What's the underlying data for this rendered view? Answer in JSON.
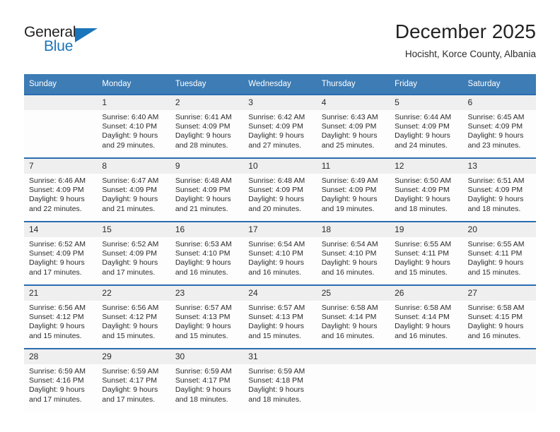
{
  "logo": {
    "text_top": "General",
    "text_bottom": "Blue",
    "accent_color": "#1b75bb",
    "triangle_icon": "triangle-icon"
  },
  "header": {
    "title": "December 2025",
    "subtitle": "Hocisht, Korce County, Albania"
  },
  "theme": {
    "header_bg": "#3d7cb5",
    "row_divider": "#2a6db0",
    "daynum_bg": "#efefef"
  },
  "calendar": {
    "weekday_headers": [
      "Sunday",
      "Monday",
      "Tuesday",
      "Wednesday",
      "Thursday",
      "Friday",
      "Saturday"
    ],
    "weeks": [
      [
        {
          "day": "",
          "lines": []
        },
        {
          "day": "1",
          "lines": [
            "Sunrise: 6:40 AM",
            "Sunset: 4:10 PM",
            "Daylight: 9 hours",
            "and 29 minutes."
          ]
        },
        {
          "day": "2",
          "lines": [
            "Sunrise: 6:41 AM",
            "Sunset: 4:09 PM",
            "Daylight: 9 hours",
            "and 28 minutes."
          ]
        },
        {
          "day": "3",
          "lines": [
            "Sunrise: 6:42 AM",
            "Sunset: 4:09 PM",
            "Daylight: 9 hours",
            "and 27 minutes."
          ]
        },
        {
          "day": "4",
          "lines": [
            "Sunrise: 6:43 AM",
            "Sunset: 4:09 PM",
            "Daylight: 9 hours",
            "and 25 minutes."
          ]
        },
        {
          "day": "5",
          "lines": [
            "Sunrise: 6:44 AM",
            "Sunset: 4:09 PM",
            "Daylight: 9 hours",
            "and 24 minutes."
          ]
        },
        {
          "day": "6",
          "lines": [
            "Sunrise: 6:45 AM",
            "Sunset: 4:09 PM",
            "Daylight: 9 hours",
            "and 23 minutes."
          ]
        }
      ],
      [
        {
          "day": "7",
          "lines": [
            "Sunrise: 6:46 AM",
            "Sunset: 4:09 PM",
            "Daylight: 9 hours",
            "and 22 minutes."
          ]
        },
        {
          "day": "8",
          "lines": [
            "Sunrise: 6:47 AM",
            "Sunset: 4:09 PM",
            "Daylight: 9 hours",
            "and 21 minutes."
          ]
        },
        {
          "day": "9",
          "lines": [
            "Sunrise: 6:48 AM",
            "Sunset: 4:09 PM",
            "Daylight: 9 hours",
            "and 21 minutes."
          ]
        },
        {
          "day": "10",
          "lines": [
            "Sunrise: 6:48 AM",
            "Sunset: 4:09 PM",
            "Daylight: 9 hours",
            "and 20 minutes."
          ]
        },
        {
          "day": "11",
          "lines": [
            "Sunrise: 6:49 AM",
            "Sunset: 4:09 PM",
            "Daylight: 9 hours",
            "and 19 minutes."
          ]
        },
        {
          "day": "12",
          "lines": [
            "Sunrise: 6:50 AM",
            "Sunset: 4:09 PM",
            "Daylight: 9 hours",
            "and 18 minutes."
          ]
        },
        {
          "day": "13",
          "lines": [
            "Sunrise: 6:51 AM",
            "Sunset: 4:09 PM",
            "Daylight: 9 hours",
            "and 18 minutes."
          ]
        }
      ],
      [
        {
          "day": "14",
          "lines": [
            "Sunrise: 6:52 AM",
            "Sunset: 4:09 PM",
            "Daylight: 9 hours",
            "and 17 minutes."
          ]
        },
        {
          "day": "15",
          "lines": [
            "Sunrise: 6:52 AM",
            "Sunset: 4:09 PM",
            "Daylight: 9 hours",
            "and 17 minutes."
          ]
        },
        {
          "day": "16",
          "lines": [
            "Sunrise: 6:53 AM",
            "Sunset: 4:10 PM",
            "Daylight: 9 hours",
            "and 16 minutes."
          ]
        },
        {
          "day": "17",
          "lines": [
            "Sunrise: 6:54 AM",
            "Sunset: 4:10 PM",
            "Daylight: 9 hours",
            "and 16 minutes."
          ]
        },
        {
          "day": "18",
          "lines": [
            "Sunrise: 6:54 AM",
            "Sunset: 4:10 PM",
            "Daylight: 9 hours",
            "and 16 minutes."
          ]
        },
        {
          "day": "19",
          "lines": [
            "Sunrise: 6:55 AM",
            "Sunset: 4:11 PM",
            "Daylight: 9 hours",
            "and 15 minutes."
          ]
        },
        {
          "day": "20",
          "lines": [
            "Sunrise: 6:55 AM",
            "Sunset: 4:11 PM",
            "Daylight: 9 hours",
            "and 15 minutes."
          ]
        }
      ],
      [
        {
          "day": "21",
          "lines": [
            "Sunrise: 6:56 AM",
            "Sunset: 4:12 PM",
            "Daylight: 9 hours",
            "and 15 minutes."
          ]
        },
        {
          "day": "22",
          "lines": [
            "Sunrise: 6:56 AM",
            "Sunset: 4:12 PM",
            "Daylight: 9 hours",
            "and 15 minutes."
          ]
        },
        {
          "day": "23",
          "lines": [
            "Sunrise: 6:57 AM",
            "Sunset: 4:13 PM",
            "Daylight: 9 hours",
            "and 15 minutes."
          ]
        },
        {
          "day": "24",
          "lines": [
            "Sunrise: 6:57 AM",
            "Sunset: 4:13 PM",
            "Daylight: 9 hours",
            "and 15 minutes."
          ]
        },
        {
          "day": "25",
          "lines": [
            "Sunrise: 6:58 AM",
            "Sunset: 4:14 PM",
            "Daylight: 9 hours",
            "and 16 minutes."
          ]
        },
        {
          "day": "26",
          "lines": [
            "Sunrise: 6:58 AM",
            "Sunset: 4:14 PM",
            "Daylight: 9 hours",
            "and 16 minutes."
          ]
        },
        {
          "day": "27",
          "lines": [
            "Sunrise: 6:58 AM",
            "Sunset: 4:15 PM",
            "Daylight: 9 hours",
            "and 16 minutes."
          ]
        }
      ],
      [
        {
          "day": "28",
          "lines": [
            "Sunrise: 6:59 AM",
            "Sunset: 4:16 PM",
            "Daylight: 9 hours",
            "and 17 minutes."
          ]
        },
        {
          "day": "29",
          "lines": [
            "Sunrise: 6:59 AM",
            "Sunset: 4:17 PM",
            "Daylight: 9 hours",
            "and 17 minutes."
          ]
        },
        {
          "day": "30",
          "lines": [
            "Sunrise: 6:59 AM",
            "Sunset: 4:17 PM",
            "Daylight: 9 hours",
            "and 18 minutes."
          ]
        },
        {
          "day": "31",
          "lines": [
            "Sunrise: 6:59 AM",
            "Sunset: 4:18 PM",
            "Daylight: 9 hours",
            "and 18 minutes."
          ]
        },
        {
          "day": "",
          "lines": []
        },
        {
          "day": "",
          "lines": []
        },
        {
          "day": "",
          "lines": []
        }
      ]
    ]
  }
}
